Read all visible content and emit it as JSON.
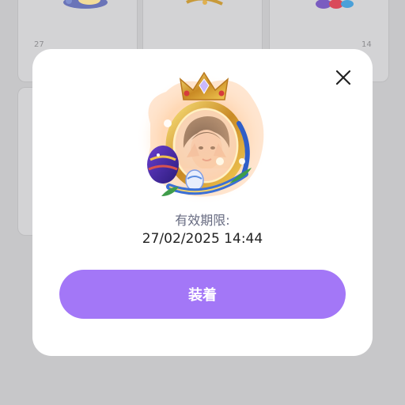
{
  "background": {
    "cards": [
      {
        "date_fragment": "27"
      },
      {
        "date_fragment": ""
      },
      {
        "date_fragment": "14"
      }
    ]
  },
  "modal": {
    "close_icon": "close-icon",
    "frame_image": "avatar-frame-easter-crown",
    "validity_label": "有效期限:",
    "validity_date": "27/02/2025 14:44",
    "equip_label": "装着"
  },
  "colors": {
    "accent": "#a377f7",
    "overlay": "#c7c7c9",
    "label": "#666a80",
    "text": "#222222"
  }
}
